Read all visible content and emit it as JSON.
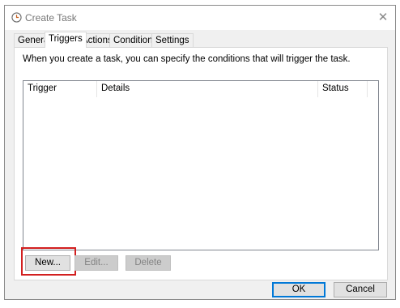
{
  "window": {
    "title": "Create Task",
    "close_glyph": "✕",
    "icon": "clock-icon"
  },
  "tabs": [
    {
      "label": "General",
      "active": false
    },
    {
      "label": "Triggers",
      "active": true
    },
    {
      "label": "Actions",
      "active": false
    },
    {
      "label": "Conditions",
      "active": false
    },
    {
      "label": "Settings",
      "active": false
    }
  ],
  "triggers": {
    "description": "When you create a task, you can specify the conditions that will trigger the task.",
    "columns": [
      "Trigger",
      "Details",
      "Status"
    ],
    "rows": [],
    "buttons": {
      "new": "New...",
      "edit": "Edit...",
      "delete": "Delete"
    }
  },
  "footer": {
    "ok": "OK",
    "cancel": "Cancel"
  },
  "colors": {
    "highlight": "#d21f1f",
    "focus": "#0078d7"
  }
}
